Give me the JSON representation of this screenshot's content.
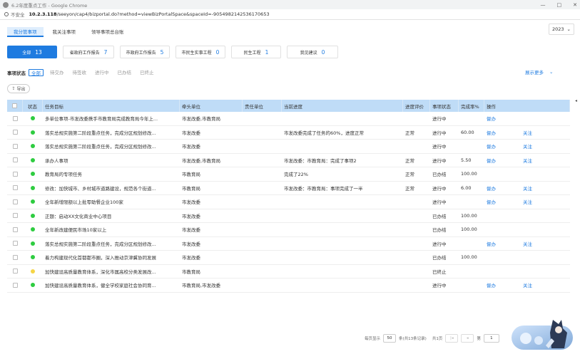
{
  "window": {
    "title": "6.2年度重点工作 - Google Chrome",
    "controls": [
      "—",
      "□",
      "✕"
    ]
  },
  "address": {
    "warning": "不安全",
    "host": "10.2.3.118",
    "path": "/seeyon/cap4/bizportal.do?method=viewBizPortalSpace&spaceId=-9054982142536170653"
  },
  "tabs": [
    {
      "label": "我分管事项",
      "active": true
    },
    {
      "label": "我关注事项",
      "active": false
    },
    {
      "label": "领导事项总台账",
      "active": false
    }
  ],
  "year": {
    "value": "2023"
  },
  "cards": [
    {
      "label": "全部",
      "count": "13",
      "active": true
    },
    {
      "label": "省政府工作报告",
      "count": "7",
      "active": false
    },
    {
      "label": "市政府工作报告",
      "count": "5",
      "active": false
    },
    {
      "label": "市民生实事工程",
      "count": "0",
      "active": false
    },
    {
      "label": "民生工程",
      "count": "1",
      "active": false
    },
    {
      "label": "我见建议",
      "count": "0",
      "active": false
    }
  ],
  "status_filter": {
    "label": "事项状态",
    "options": [
      {
        "label": "全部",
        "active": true
      },
      {
        "label": "待交办",
        "active": false
      },
      {
        "label": "待签收",
        "active": false
      },
      {
        "label": "进行中",
        "active": false
      },
      {
        "label": "已办结",
        "active": false
      },
      {
        "label": "已终止",
        "active": false
      }
    ],
    "show_more": "展示更多"
  },
  "export_label": "导出",
  "table": {
    "headers": {
      "status": "状态",
      "name": "任务目标",
      "lead": "牵头单位",
      "resp": "责任单位",
      "progress": "当前进度",
      "eval": "进度评价",
      "state": "事项状态",
      "rate": "完成率%",
      "ops": "操作"
    },
    "rows": [
      {
        "dot": "#2ecc40",
        "name": "多单位事项-市发改委携手市教育局完成教育局今年上...",
        "lead": "市发改委,市教育局",
        "resp": "",
        "progress": "",
        "eval": "",
        "state": "进行中",
        "rate": "",
        "view": "督办",
        "follow": ""
      },
      {
        "dot": "#2ecc40",
        "name": "落实总规实施第二阶段重点任务，完成分区规划修改...",
        "lead": "市发改委",
        "resp": "",
        "progress": "市发改委完成了任务的60%，进度正常",
        "eval": "正常",
        "state": "进行中",
        "rate": "60.00",
        "view": "督办",
        "follow": "关注"
      },
      {
        "dot": "#2ecc40",
        "name": "落实总规实施第二阶段重点任务，完成分区规划修改...",
        "lead": "市发改委",
        "resp": "",
        "progress": "",
        "eval": "",
        "state": "进行中",
        "rate": "",
        "view": "督办",
        "follow": "关注"
      },
      {
        "dot": "#2ecc40",
        "name": "承办人事项",
        "lead": "市发改委,市教育局",
        "resp": "",
        "progress": "市发改委：市教育局：完成了事项2",
        "eval": "正常",
        "state": "进行中",
        "rate": "5.50",
        "view": "督办",
        "follow": "关注"
      },
      {
        "dot": "#2ecc40",
        "name": "教育局的专项任务",
        "lead": "市教育局",
        "resp": "",
        "progress": "完成了22%",
        "eval": "正常",
        "state": "已办结",
        "rate": "100.00",
        "view": "",
        "follow": ""
      },
      {
        "dot": "#2ecc40",
        "name": "修改：加快城市、乡村城市道路建设，规范各个街道...",
        "lead": "市教育局",
        "resp": "",
        "progress": "市发改委：市教育局：事项完成了一半",
        "eval": "正常",
        "state": "进行中",
        "rate": "6.00",
        "view": "督办",
        "follow": "关注"
      },
      {
        "dot": "#2ecc40",
        "name": "全年新增限额以上批零助餐企业100家",
        "lead": "市发改委",
        "resp": "",
        "progress": "",
        "eval": "",
        "state": "进行中",
        "rate": "",
        "view": "督办",
        "follow": "关注"
      },
      {
        "dot": "#2ecc40",
        "name": "正题：启动XX文化商业中心项目",
        "lead": "市发改委",
        "resp": "",
        "progress": "",
        "eval": "",
        "state": "已办结",
        "rate": "100.00",
        "view": "",
        "follow": ""
      },
      {
        "dot": "#2ecc40",
        "name": "全年新改建便民市场10家以上",
        "lead": "市发改委",
        "resp": "",
        "progress": "",
        "eval": "",
        "state": "已办结",
        "rate": "100.00",
        "view": "",
        "follow": ""
      },
      {
        "dot": "#2ecc40",
        "name": "落实总规实施第二阶段重点任务，完成分区规划修改...",
        "lead": "市发改委",
        "resp": "",
        "progress": "",
        "eval": "",
        "state": "进行中",
        "rate": "",
        "view": "督办",
        "follow": "关注"
      },
      {
        "dot": "#2ecc40",
        "name": "着力构建现代化首都都市圈，深入推动京津冀协同发展",
        "lead": "市发改委",
        "resp": "",
        "progress": "",
        "eval": "",
        "state": "已办结",
        "rate": "100.00",
        "view": "",
        "follow": ""
      },
      {
        "dot": "#f5d547",
        "name": "加快建设高质量教育体系，深化市属高校分类发展改...",
        "lead": "市教育局",
        "resp": "",
        "progress": "",
        "eval": "",
        "state": "已终止",
        "rate": "",
        "view": "",
        "follow": ""
      },
      {
        "dot": "#2ecc40",
        "name": "加快建设高质量教育体系，健全学校家庭社会协同育...",
        "lead": "市教育局,市发改委",
        "resp": "",
        "progress": "",
        "eval": "",
        "state": "进行中",
        "rate": "",
        "view": "督办",
        "follow": "关注"
      }
    ]
  },
  "pager": {
    "per_page_label": "每页显示",
    "per_page": "50",
    "total": "条(共13条记录)",
    "pages": "共1页",
    "goto_label": "第",
    "page": "1"
  },
  "colors": {
    "accent": "#1e7be0",
    "header_bg": "#bfdcf7"
  }
}
